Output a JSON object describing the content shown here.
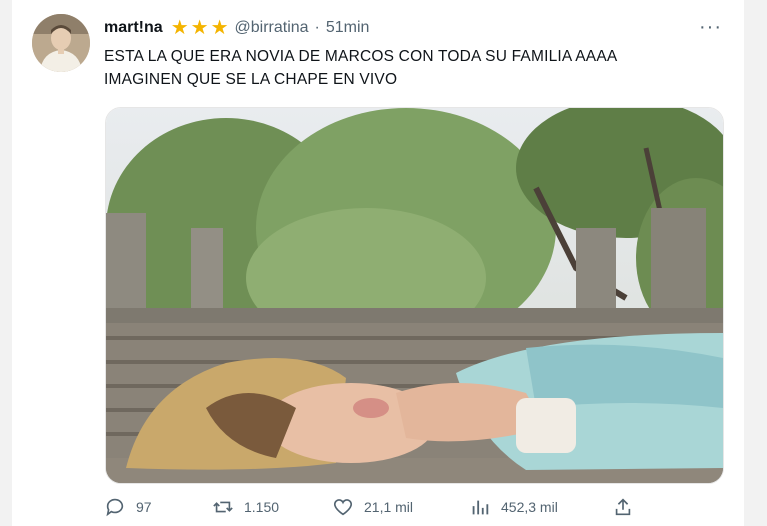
{
  "tweet": {
    "display_name": "mart!na",
    "handle": "@birratina",
    "separator": "·",
    "time": "51min",
    "more_label": "···",
    "text_lines": [
      "ESTA LA QUE ERA NOVIA DE MARCOS CON TODA SU FAMILIA AAAA",
      "IMAGINEN QUE SE LA CHAPE EN VIVO"
    ],
    "badges": [
      "star-icon",
      "star-icon",
      "star-icon"
    ],
    "colors": {
      "star": "#f4b400",
      "secondary_text": "#536471"
    }
  },
  "actions": {
    "reply_count": "97",
    "retweet_count": "1.150",
    "like_count": "21,1 mil",
    "view_count": "452,3 mil"
  }
}
